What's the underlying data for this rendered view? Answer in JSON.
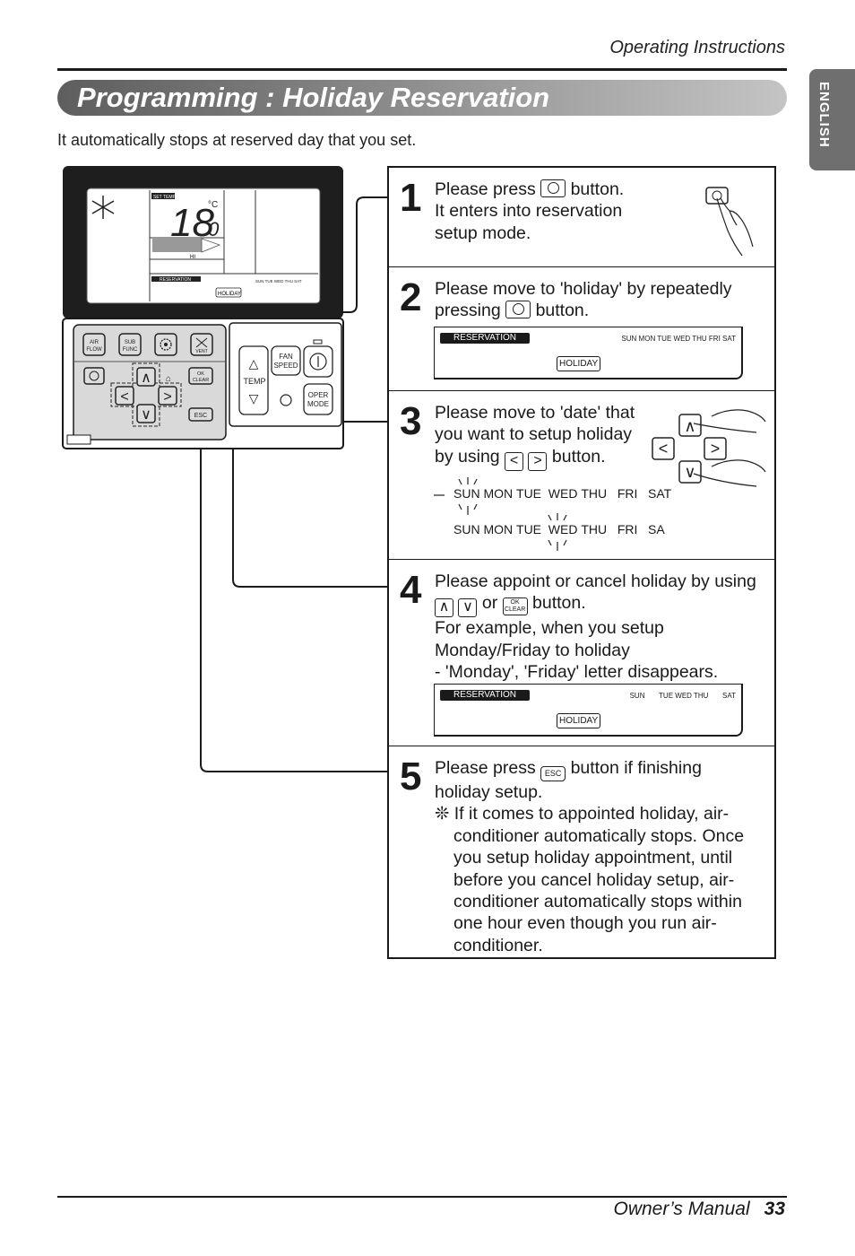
{
  "header": {
    "section": "Operating Instructions",
    "language_tab": "ENGLISH"
  },
  "title": "Programming : Holiday Reservation",
  "intro": "It automatically stops at reserved day that you set.",
  "remote": {
    "lcd": {
      "set_temp_label": "SET TEMP",
      "temperature": "18",
      "temperature_decimal": ".0",
      "unit": "°C",
      "fan_level": "HI",
      "reservation_label": "RESERVATION",
      "holiday_label": "HOLIDAY",
      "days": [
        "SUN",
        "TUE",
        "WED",
        "THU",
        "SAT"
      ]
    },
    "buttons": {
      "air_flow": "AIR FLOW",
      "sub_func": "SUB FUNC",
      "settings": "gear",
      "vent": "VENT",
      "reservation": "clock",
      "up": "∧",
      "down": "∨",
      "left": "<",
      "right": ">",
      "ok_clear_top": "OK",
      "ok_clear_bottom": "CLEAR",
      "esc": "ESC",
      "temp": "TEMP",
      "fan_speed_1": "FAN",
      "fan_speed_2": "SPEED",
      "power": "power",
      "oper_mode_1": "OPER",
      "oper_mode_2": "MODE"
    }
  },
  "steps": [
    {
      "number": "1",
      "line1_a": "Please press",
      "line1_b": "button.",
      "line2": "It enters into reservation",
      "line3": "setup mode."
    },
    {
      "number": "2",
      "line1": "Please move to 'holiday' by repeatedly",
      "line2_a": "pressing",
      "line2_b": "button.",
      "display": {
        "reservation_label": "RESERVATION",
        "holiday_label": "HOLIDAY",
        "days": "SUN MON TUE WED THU  FRI  SAT"
      }
    },
    {
      "number": "3",
      "line1": "Please move to 'date' that",
      "line2": "you want to setup holiday",
      "line3_a": "by using",
      "line3_b": "button.",
      "days_row_1": [
        "SUN",
        "MON",
        "TUE",
        "WED",
        "THU",
        "FRI",
        "SAT"
      ],
      "days_row_2": [
        "SUN",
        "MON",
        "TUE",
        "WED",
        "THU",
        "FRI",
        "SA"
      ]
    },
    {
      "number": "4",
      "line1": "Please appoint or cancel holiday by using",
      "line2_or": "or",
      "line2_b": "button.",
      "line3": "For example, when you setup",
      "line4": "Monday/Friday to holiday",
      "line5": "- 'Monday', 'Friday' letter disappears.",
      "display": {
        "reservation_label": "RESERVATION",
        "holiday_label": "HOLIDAY",
        "days": [
          "SUN",
          "TUE",
          "WED",
          "THU",
          "SAT"
        ]
      }
    },
    {
      "number": "5",
      "line1_a": "Please press",
      "line1_b": "button if finishing",
      "line2": "holiday setup.",
      "note": "❊ If it comes to appointed holiday, air-conditioner automatically stops. Once you setup holiday appointment, until before you cancel holiday setup, air-conditioner automatically stops within one hour even though you run air-conditioner."
    }
  ],
  "footer": {
    "manual": "Owner’s Manual",
    "page": "33"
  }
}
